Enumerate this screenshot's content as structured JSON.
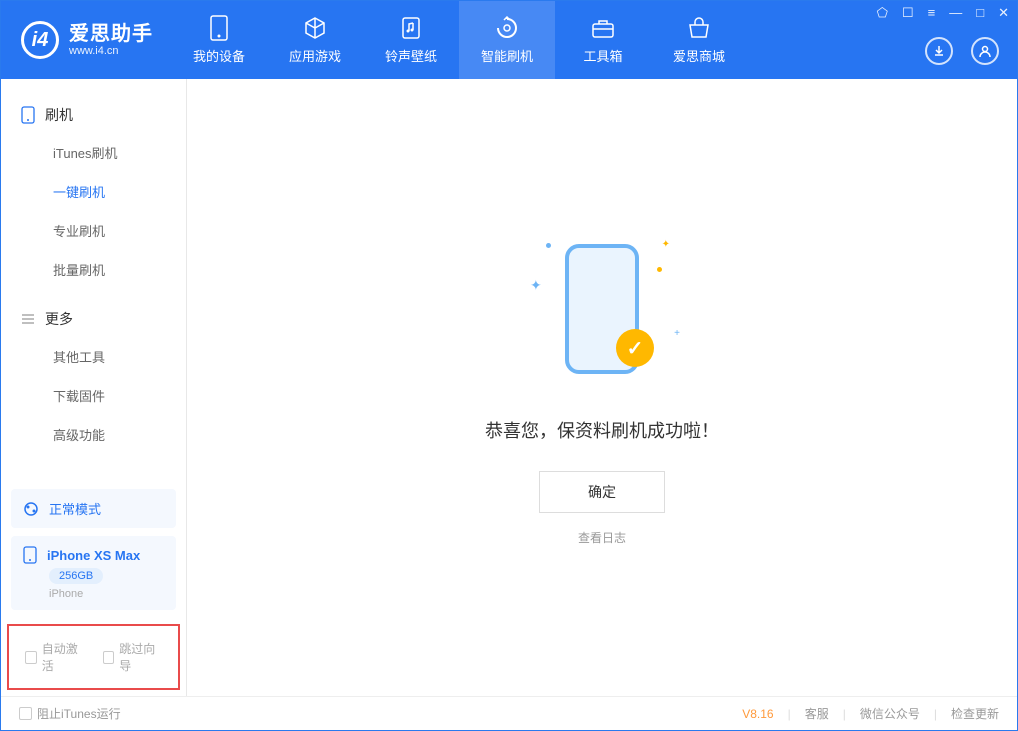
{
  "app": {
    "title": "爱思助手",
    "url": "www.i4.cn"
  },
  "nav": {
    "tabs": [
      {
        "label": "我的设备",
        "icon": "device"
      },
      {
        "label": "应用游戏",
        "icon": "cube"
      },
      {
        "label": "铃声壁纸",
        "icon": "music"
      },
      {
        "label": "智能刷机",
        "icon": "refresh",
        "active": true
      },
      {
        "label": "工具箱",
        "icon": "toolbox"
      },
      {
        "label": "爱思商城",
        "icon": "shop"
      }
    ]
  },
  "sidebar": {
    "sections": [
      {
        "title": "刷机",
        "icon": "phone",
        "items": [
          {
            "label": "iTunes刷机"
          },
          {
            "label": "一键刷机",
            "active": true
          },
          {
            "label": "专业刷机"
          },
          {
            "label": "批量刷机"
          }
        ]
      },
      {
        "title": "更多",
        "icon": "menu",
        "items": [
          {
            "label": "其他工具"
          },
          {
            "label": "下载固件"
          },
          {
            "label": "高级功能"
          }
        ]
      }
    ],
    "mode": "正常模式",
    "device": {
      "name": "iPhone XS Max",
      "capacity": "256GB",
      "type": "iPhone"
    },
    "checkboxes": {
      "autoActivate": "自动激活",
      "skipGuide": "跳过向导"
    }
  },
  "main": {
    "successText": "恭喜您，保资料刷机成功啦！",
    "okButton": "确定",
    "viewLog": "查看日志"
  },
  "footer": {
    "blockItunes": "阻止iTunes运行",
    "version": "V8.16",
    "links": {
      "service": "客服",
      "wechat": "微信公众号",
      "update": "检查更新"
    }
  }
}
